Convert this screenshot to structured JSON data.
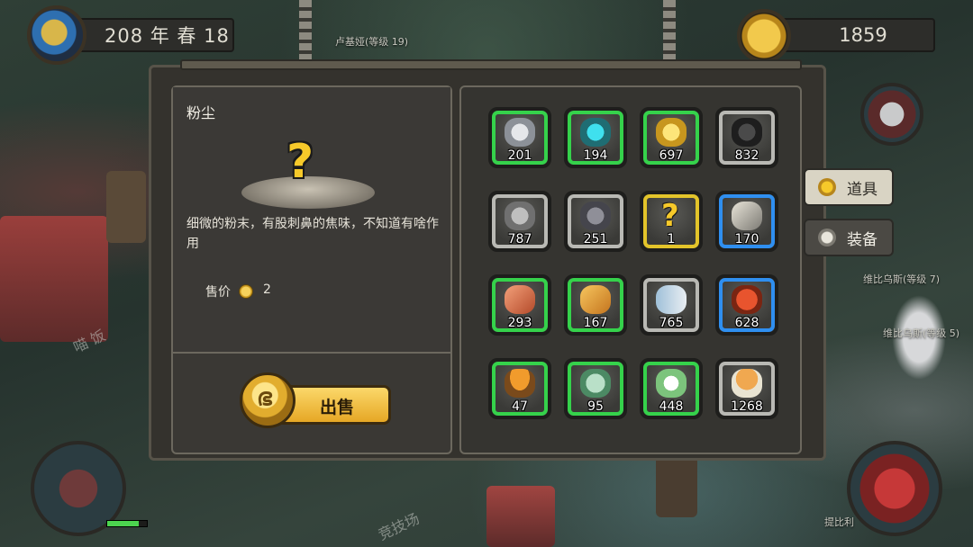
{
  "header": {
    "date": "208 年 春 18",
    "gold": "1859"
  },
  "world_labels": {
    "npc_top": "卢基娅(等级 19)",
    "npc_right_1": "维比乌斯(等级 7)",
    "npc_right_2": "维比乌斯(等级 5)",
    "npc_bottom_right": "提比利",
    "ground_left": "喵 饭",
    "ground_bottom": "竞技场"
  },
  "detail": {
    "title": "粉尘",
    "description": "细微的粉末，有股刺鼻的焦味，不知道有啥作用",
    "price_label": "售价",
    "price_value": "2",
    "sell_button": "出售"
  },
  "tabs": [
    {
      "label": "道具",
      "icon": "pouch-icon",
      "active": true
    },
    {
      "label": "装备",
      "icon": "helmet-icon",
      "active": false
    }
  ],
  "inventory": [
    {
      "icon": "silver-ore-icon",
      "qty": "201",
      "rarity": "green"
    },
    {
      "icon": "blue-crystal-ore-icon",
      "qty": "194",
      "rarity": "green"
    },
    {
      "icon": "gold-ore-icon",
      "qty": "697",
      "rarity": "green"
    },
    {
      "icon": "coal-icon",
      "qty": "832",
      "rarity": "gray"
    },
    {
      "icon": "stone-icon",
      "qty": "787",
      "rarity": "gray"
    },
    {
      "icon": "iron-ore-icon",
      "qty": "251",
      "rarity": "gray"
    },
    {
      "icon": "unknown-dust-icon",
      "qty": "1",
      "rarity": "selected"
    },
    {
      "icon": "horn-icon",
      "qty": "170",
      "rarity": "blue"
    },
    {
      "icon": "claw-icon",
      "qty": "293",
      "rarity": "green"
    },
    {
      "icon": "feather-icon",
      "qty": "167",
      "rarity": "green"
    },
    {
      "icon": "fish-icon",
      "qty": "765",
      "rarity": "gray"
    },
    {
      "icon": "pumpkin-icon",
      "qty": "628",
      "rarity": "blue"
    },
    {
      "icon": "orange-mushroom-icon",
      "qty": "47",
      "rarity": "green"
    },
    {
      "icon": "herb-leaf-icon",
      "qty": "95",
      "rarity": "green"
    },
    {
      "icon": "white-flower-icon",
      "qty": "448",
      "rarity": "green"
    },
    {
      "icon": "spotted-mushroom-icon",
      "qty": "1268",
      "rarity": "gray"
    }
  ],
  "colors": {
    "green": "#35d24b",
    "blue": "#2f8ff0",
    "gray": "#b9b9b4",
    "selected": "#e3c42a"
  }
}
